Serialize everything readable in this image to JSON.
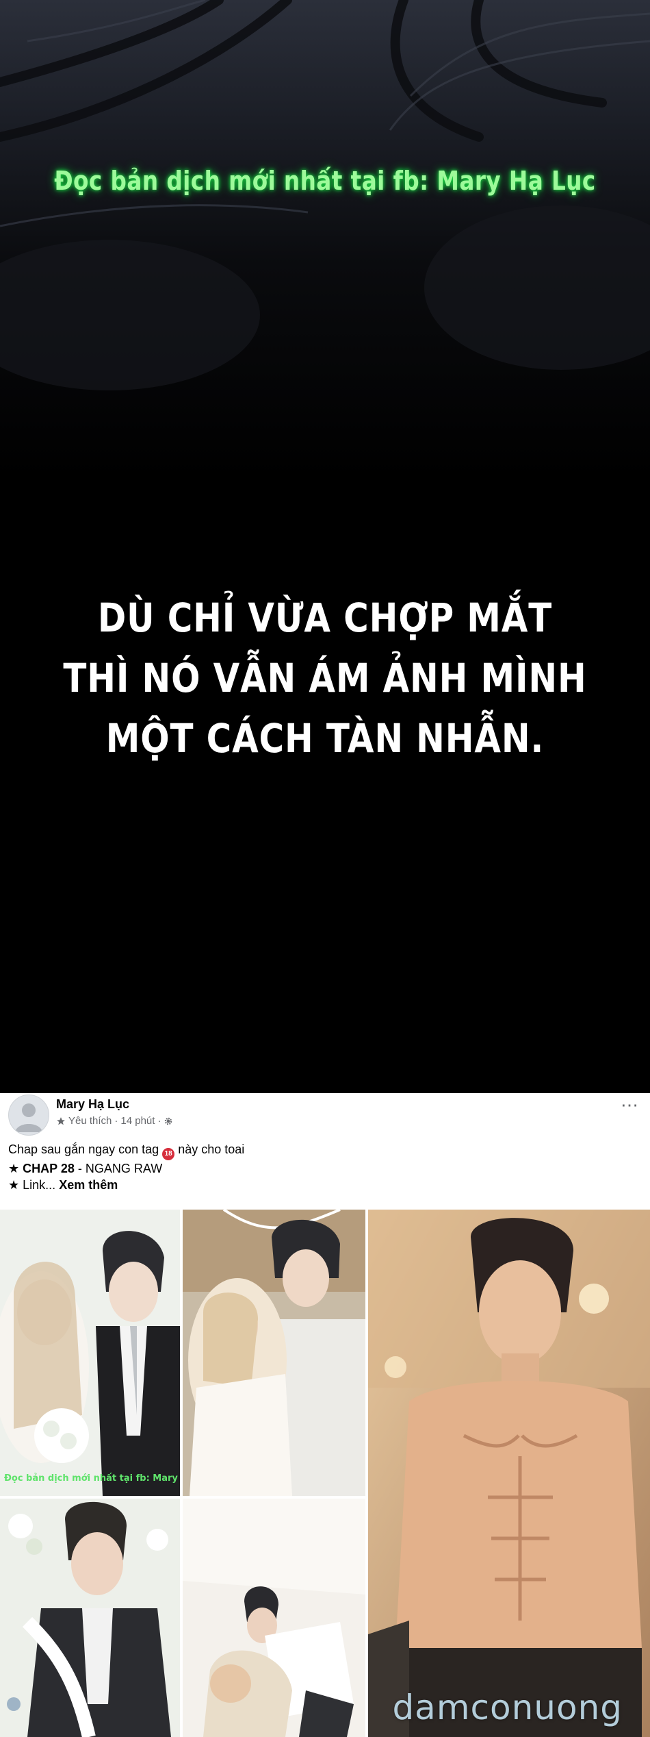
{
  "comic": {
    "watermark": "Đọc bản dịch mới nhất tại fb: Mary Hạ Lục",
    "caption_lines": [
      "DÙ CHỈ VỪA CHỢP MẮT",
      "THÌ NÓ VẪN ÁM ẢNH MÌNH",
      "MỘT CÁCH TÀN NHẪN."
    ]
  },
  "post": {
    "author": "Mary Hạ Lục",
    "meta_like": "Yêu thích",
    "meta_time": "14 phút",
    "more_icon": "⋯",
    "line1_before": "Chap sau gắn ngay con tag",
    "line1_after": "này cho toai",
    "line2_star": "★",
    "line2_bold": "CHAP 28",
    "line2_rest": " - NGANG RAW",
    "line3_star": "★",
    "line3_text": "Link...",
    "line3_more": "Xem thêm"
  },
  "images": {
    "photo1_watermark": "Đọc bản dịch mới nhất tại fb: Mary Hạ Lục",
    "site_watermark": "damconuong"
  },
  "icons": {
    "star": "star-icon",
    "settings": "gear-icon",
    "tag": "tag-emoji-icon",
    "more": "more-options-icon"
  },
  "colors": {
    "watermark_glow": "#1fe04a",
    "caption": "#ffffff",
    "fb_text": "#050505",
    "fb_meta": "#65676b"
  }
}
